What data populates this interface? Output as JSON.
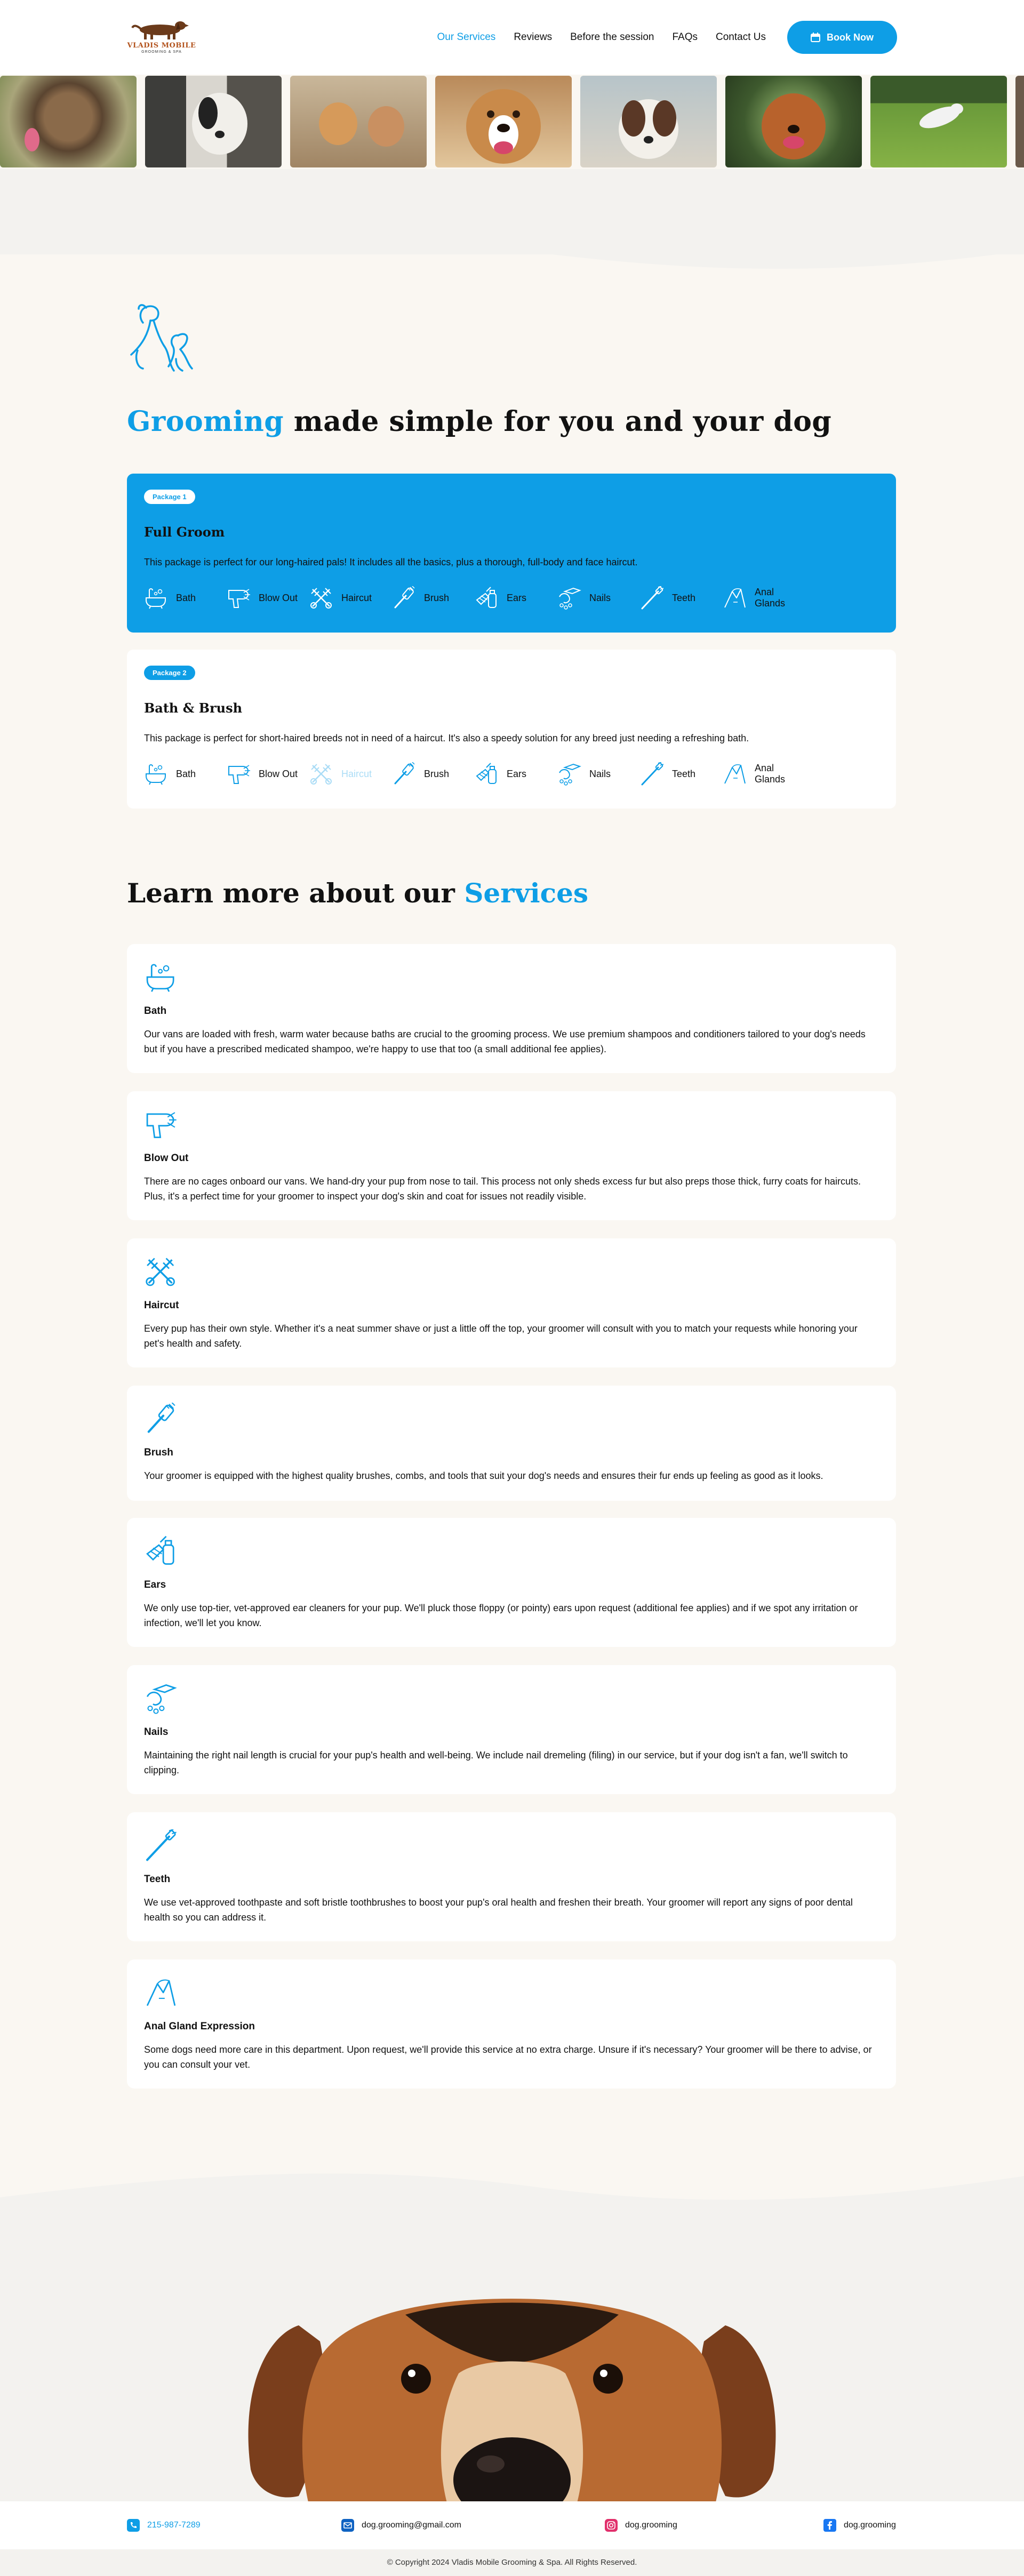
{
  "brand": {
    "name": "VLADIS MOBILE",
    "sub": "GROOMING & SPA"
  },
  "nav": {
    "items": [
      "Our Services",
      "Reviews",
      "Before the session",
      "FAQs",
      "Contact Us"
    ],
    "active": "Our Services",
    "book_label": "Book Now"
  },
  "hero": {
    "title_accent": "Grooming",
    "title_rest": " made simple for you and your dog"
  },
  "features": [
    "Bath",
    "Blow Out",
    "Haircut",
    "Brush",
    "Ears",
    "Nails",
    "Teeth",
    "Anal Glands"
  ],
  "packages": [
    {
      "badge": "Package 1",
      "title": "Full Groom",
      "desc": "This package is perfect for our long-haired pals! It includes all the basics, plus a thorough, full-body and face haircut."
    },
    {
      "badge": "Package 2",
      "title": "Bath & Brush",
      "desc": "This package is perfect for short-haired breeds not in need of a haircut. It's also a speedy solution for any breed just needing a refreshing bath."
    }
  ],
  "services": {
    "title_lead": "Learn more about our ",
    "title_accent": "Services",
    "items": [
      {
        "name": "Bath",
        "desc": "Our vans are loaded with fresh, warm water because baths are crucial to the grooming process. We use premium shampoos and conditioners tailored to your dog's needs but if you have a prescribed medicated shampoo, we're happy to use that too (a small additional fee applies)."
      },
      {
        "name": "Blow Out",
        "desc": "There are no cages onboard our vans. We hand-dry your pup from nose to tail. This process not only sheds excess fur but also preps those thick, furry coats for haircuts. Plus, it's a perfect time for your groomer to inspect your dog's skin and coat for issues not readily visible."
      },
      {
        "name": "Haircut",
        "desc": "Every pup has their own style. Whether it's a neat summer shave or just a little off the top, your groomer will consult with you to match your requests while honoring your pet's health and safety."
      },
      {
        "name": "Brush",
        "desc": "Your groomer is equipped with the highest quality brushes, combs, and tools that suit your dog's needs and ensures their fur ends up feeling as good as it looks."
      },
      {
        "name": "Ears",
        "desc": "We only use top-tier, vet-approved ear cleaners for your pup. We'll pluck those floppy (or pointy) ears upon request (additional fee applies) and if we spot any irritation or infection, we'll let you know."
      },
      {
        "name": "Nails",
        "desc": "Maintaining the right nail length is crucial for your pup's health and well-being. We include nail dremeling (filing) in our service, but if your dog isn't a fan, we'll switch to clipping."
      },
      {
        "name": "Teeth",
        "desc": "We use vet-approved toothpaste and soft bristle toothbrushes to boost your pup's oral health and freshen their breath. Your groomer will report any signs of poor dental health so you can address it."
      },
      {
        "name": "Anal Gland Expression",
        "desc": "Some dogs need more care in this department. Upon request, we'll provide this service at no extra charge. Unsure if it's necessary? Your groomer will be there to advise, or you can consult your vet."
      }
    ]
  },
  "footer": {
    "phone": "215-987-7289",
    "email": "dog.grooming@gmail.com",
    "instagram": "dog.grooming",
    "facebook": "dog.grooming",
    "copyright": "© Copyright 2024 Vladis Mobile Grooming & Spa. All Rights Reserved."
  },
  "colors": {
    "accent": "#0e9ee6",
    "page_bg": "#faf7f2",
    "band_bg": "#f3f2ef"
  }
}
